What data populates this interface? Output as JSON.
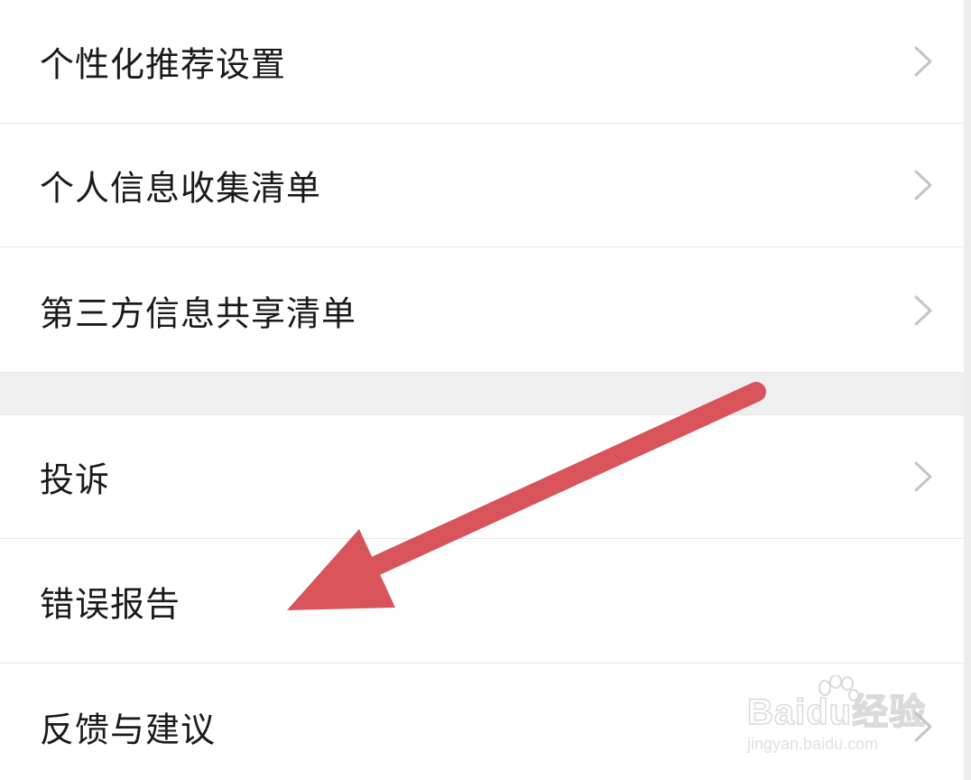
{
  "menu": {
    "items": [
      {
        "label": "个性化推荐设置",
        "chevron": true
      },
      {
        "label": "个人信息收集清单",
        "chevron": true
      },
      {
        "label": "第三方信息共享清单",
        "chevron": true
      },
      {
        "label": "投诉",
        "chevron": true
      },
      {
        "label": "错误报告",
        "chevron": false
      },
      {
        "label": "反馈与建议",
        "chevron": true
      }
    ]
  },
  "annotation": {
    "arrow_color": "#d9535b",
    "target": "错误报告"
  },
  "watermark": {
    "brand": "Baidu经验",
    "url": "jingyan.baidu.com"
  },
  "colors": {
    "background": "#ffffff",
    "divider": "#e6e6e6",
    "section_gap": "#efefef",
    "text": "#1a1a1a",
    "chevron": "#c4c4c4"
  }
}
